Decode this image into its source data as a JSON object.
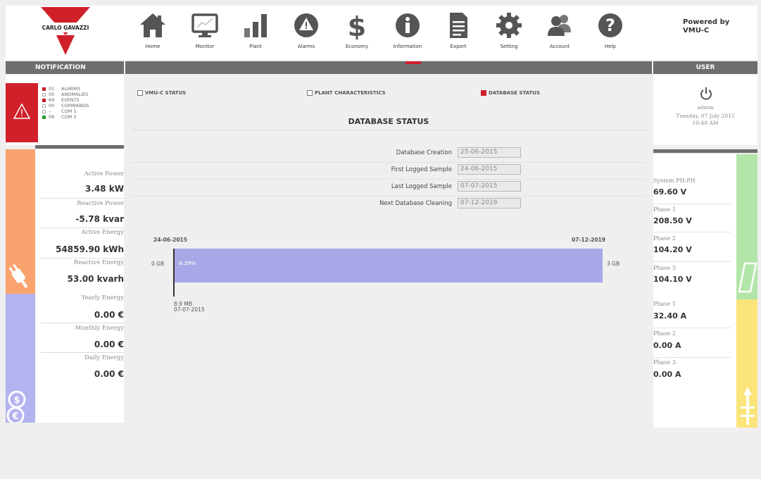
{
  "header": {
    "logo_text": "CARLO GAVAZZI",
    "powered_by_line1": "Powered by",
    "powered_by_line2": "VMU-C",
    "nav": [
      {
        "label": "Home",
        "icon": "home-icon"
      },
      {
        "label": "Monitor",
        "icon": "monitor-icon"
      },
      {
        "label": "Plant",
        "icon": "plant-icon"
      },
      {
        "label": "Alarms",
        "icon": "alarms-icon"
      },
      {
        "label": "Economy",
        "icon": "economy-icon"
      },
      {
        "label": "Information",
        "icon": "information-icon"
      },
      {
        "label": "Export",
        "icon": "export-icon"
      },
      {
        "label": "Setting",
        "icon": "setting-icon"
      },
      {
        "label": "Account",
        "icon": "account-icon"
      },
      {
        "label": "Help",
        "icon": "help-icon"
      }
    ]
  },
  "bars": {
    "notification": "NOTIFICATION",
    "user": "USER"
  },
  "notifications": [
    {
      "status": "red",
      "count": "01",
      "label": "ALARMS"
    },
    {
      "status": "empty",
      "count": "00",
      "label": "ANOMALIES"
    },
    {
      "status": "red",
      "count": "69",
      "label": "EVENTS"
    },
    {
      "status": "empty",
      "count": "00",
      "label": "COMMANDS"
    },
    {
      "status": "empty",
      "count": "--",
      "label": "COM 1"
    },
    {
      "status": "green",
      "count": "06",
      "label": "COM 3"
    }
  ],
  "left_stats": {
    "active_power": {
      "label": "Active Power",
      "value": "3.48 kW"
    },
    "reactive_power": {
      "label": "Reactive Power",
      "value": "-5.78 kvar"
    },
    "active_energy": {
      "label": "Active Energy",
      "value": "54859.90 kWh"
    },
    "reactive_energy": {
      "label": "Reactive Energy",
      "value": "53.00 kvarh"
    },
    "yearly_energy": {
      "label": "Yearly Energy",
      "value": "0.00 €"
    },
    "monthly_energy": {
      "label": "Monthly Energy",
      "value": "0.00 €"
    },
    "daily_energy": {
      "label": "Daily Energy",
      "value": "0.00 €"
    }
  },
  "tabs": [
    {
      "label": "VMU-C STATUS",
      "checked": false
    },
    {
      "label": "PLANT CHARACTERISTICS",
      "checked": false
    },
    {
      "label": "DATABASE STATUS",
      "checked": true
    }
  ],
  "database": {
    "title": "DATABASE STATUS",
    "fields": [
      {
        "label": "Database Creation",
        "value": "25-06-2015"
      },
      {
        "label": "First Logged Sample",
        "value": "24-06-2015"
      },
      {
        "label": "Last Logged Sample",
        "value": "07-07-2015"
      },
      {
        "label": "Next Database Cleaning",
        "value": "07-12-2019"
      }
    ],
    "bar": {
      "start_date": "24-06-2015",
      "end_date": "07-12-2019",
      "min_label": "0 GB",
      "max_label": "3 GB",
      "percent_label": "0.29%",
      "used_size": "8.9 MB",
      "used_date": "07-07-2015"
    }
  },
  "user": {
    "name": "admin",
    "date": "Tuesday, 07 July 2015",
    "time": "10:48 AM"
  },
  "right_stats": {
    "system_ph_ph": {
      "label": "System PH-PH",
      "value": "69.60 V"
    },
    "phase1_v": {
      "label": "Phase 1",
      "value": "208.50 V"
    },
    "phase2_v": {
      "label": "Phase 2",
      "value": "104.20 V"
    },
    "phase3_v": {
      "label": "Phase 3",
      "value": "104.10 V"
    },
    "phase1_a": {
      "label": "Phase 1",
      "value": "32.40 A"
    },
    "phase2_a": {
      "label": "Phase 2",
      "value": "0.00 A"
    },
    "phase3_a": {
      "label": "Phase 3",
      "value": "0.00 A"
    }
  },
  "colors": {
    "brand_red": "#d0202a",
    "bar_grey": "#6e6e6e",
    "orange": "#f9a46e",
    "purple": "#b3b3ef",
    "green": "#b2e6a9",
    "yellow": "#fbe47a",
    "usage_bar": "#a8a8e8"
  }
}
